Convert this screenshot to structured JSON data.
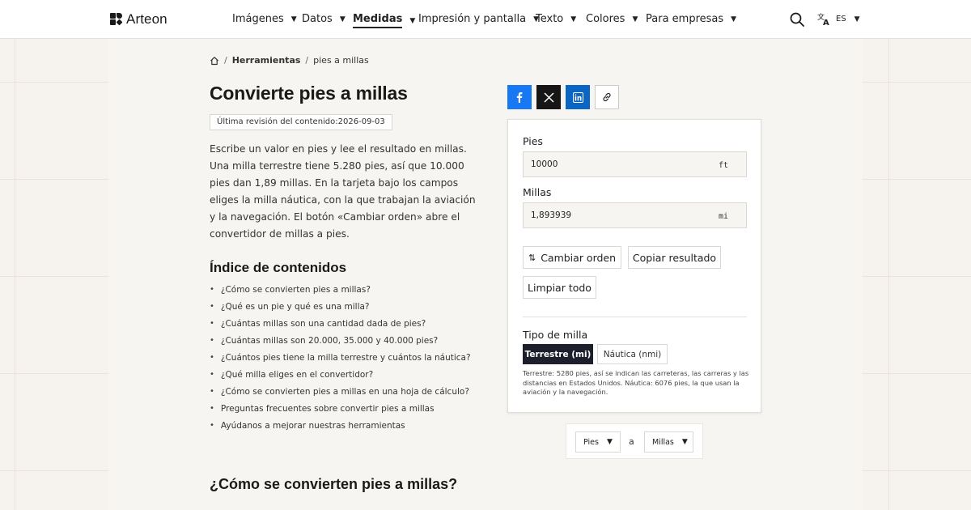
{
  "brand": {
    "name": "Arteon"
  },
  "nav": {
    "items": [
      {
        "label": "Imágenes"
      },
      {
        "label": "Datos"
      },
      {
        "label": "Medidas"
      },
      {
        "label": "Impresión y pantalla"
      },
      {
        "label": "Texto"
      },
      {
        "label": "Colores"
      },
      {
        "label": "Para empresas"
      }
    ],
    "active": "Medidas",
    "lang_code": "ES"
  },
  "breadcrumb": {
    "section": "Herramientas",
    "current": "pies a millas"
  },
  "page": {
    "title": "Convierte pies a millas",
    "revision": "Última revisión del contenido:2026-09-03",
    "intro": "Escribe un valor en pies y lee el resultado en millas. Una milla terrestre tiene 5.280 pies, así que 10.000 pies dan 1,89 millas. En la tarjeta bajo los campos eliges la milla náutica, con la que trabajan la aviación y la navegación. El botón «Cambiar orden» abre el convertidor de millas a pies.",
    "toc_title": "Índice de contenidos",
    "toc": [
      "¿Cómo se convierten pies a millas?",
      "¿Qué es un pie y qué es una milla?",
      "¿Cuántas millas son una cantidad dada de pies?",
      "¿Cuántas millas son 20.000, 35.000 y 40.000 pies?",
      "¿Cuántos pies tiene la milla terrestre y cuántos la náutica?",
      "¿Qué milla eliges en el convertidor?",
      "¿Cómo se convierten pies a millas en una hoja de cálculo?",
      "Preguntas frecuentes sobre convertir pies a millas",
      "Ayúdanos a mejorar nuestras herramientas"
    ],
    "section_heading": "¿Cómo se convierten pies a millas?"
  },
  "share": {
    "icons": [
      "facebook-icon",
      "x-icon",
      "linkedin-icon",
      "link-icon"
    ]
  },
  "converter": {
    "from_label": "Pies",
    "from_value": "10000",
    "from_unit": "ft",
    "to_label": "Millas",
    "to_value": "1,893939",
    "to_unit": "mi",
    "swap_label": "Cambiar orden",
    "copy_label": "Copiar resultado",
    "clear_label": "Limpiar todo",
    "mile_type_label": "Tipo de milla",
    "mile_options": [
      "Terrestre (mi)",
      "Náutica (nmi)"
    ],
    "mile_selected": "Terrestre (mi)",
    "note": "Terrestre: 5280 pies, así se indican las carreteras, las carreras y las distancias en Estados Unidos. Náutica: 6076 pies, la que usan la aviación y la navegación."
  },
  "unit_selector": {
    "from": "Pies",
    "connector": "a",
    "to": "Millas"
  },
  "colors": {
    "accent_dark": "#1d1f2c",
    "facebook": "#1877f2",
    "linkedin": "#0a66c2",
    "x": "#161616"
  }
}
